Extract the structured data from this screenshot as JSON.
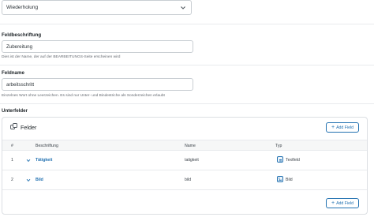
{
  "return_format": {
    "selected": "Wiederholung"
  },
  "field_label": {
    "label": "Feldbeschriftung",
    "value": "Zubereitung",
    "help": "Dies ist der Name, der auf der BEARBEITUNGS-Seite erscheinen wird"
  },
  "field_name": {
    "label": "Feldname",
    "value": "arbeitsschritt",
    "help": "Einzelnes Wort ohne Leerzeichen. Es sind nur Unter- und Bindestriche als Sonderzeichen erlaubt"
  },
  "subfields": {
    "section_label": "Unterfelder",
    "panel_title": "Felder",
    "add_button_label": "Add Field",
    "columns": {
      "index": "#",
      "label": "Beschriftung",
      "name": "Name",
      "type": "Typ"
    },
    "rows": [
      {
        "index": "1",
        "label": "Tätigkeit",
        "name": "tatigkeit",
        "type": "Textfeld",
        "type_icon": "text-field-icon"
      },
      {
        "index": "2",
        "label": "Bild",
        "name": "bild",
        "type": "Bild",
        "type_icon": "image-icon"
      }
    ]
  },
  "colors": {
    "accent": "#2271b1",
    "border": "#c9ced3"
  }
}
